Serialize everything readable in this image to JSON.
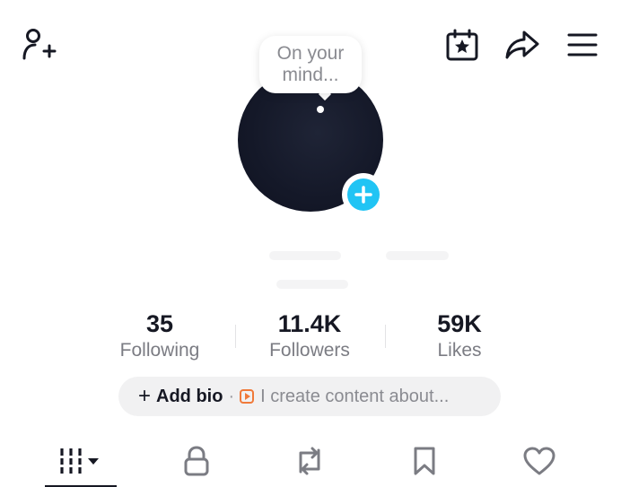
{
  "bubble": {
    "text": "On your mind..."
  },
  "stats": [
    {
      "value": "35",
      "label": "Following"
    },
    {
      "value": "11.4K",
      "label": "Followers"
    },
    {
      "value": "59K",
      "label": "Likes"
    }
  ],
  "bio": {
    "add_label": "Add bio",
    "separator": "·",
    "prompt": "I create content about..."
  },
  "icons": {
    "top_left": "add-friend-icon",
    "calendar": "calendar-star-icon",
    "share": "share-arrow-icon",
    "menu": "hamburger-menu-icon",
    "add_avatar": "plus-icon"
  },
  "tabs": [
    {
      "name": "videos-tab",
      "icon": "grid-columns-icon",
      "active": true
    },
    {
      "name": "private-tab",
      "icon": "lock-icon",
      "active": false
    },
    {
      "name": "reposts-tab",
      "icon": "repost-icon",
      "active": false
    },
    {
      "name": "favorites-tab",
      "icon": "bookmark-icon",
      "active": false
    },
    {
      "name": "liked-tab",
      "icon": "heart-icon",
      "active": false
    }
  ],
  "colors": {
    "accent": "#20c4f4",
    "text": "#161823",
    "muted": "#7b7c83",
    "bio_icon": "#f07a3a",
    "avatar": "#141828"
  }
}
